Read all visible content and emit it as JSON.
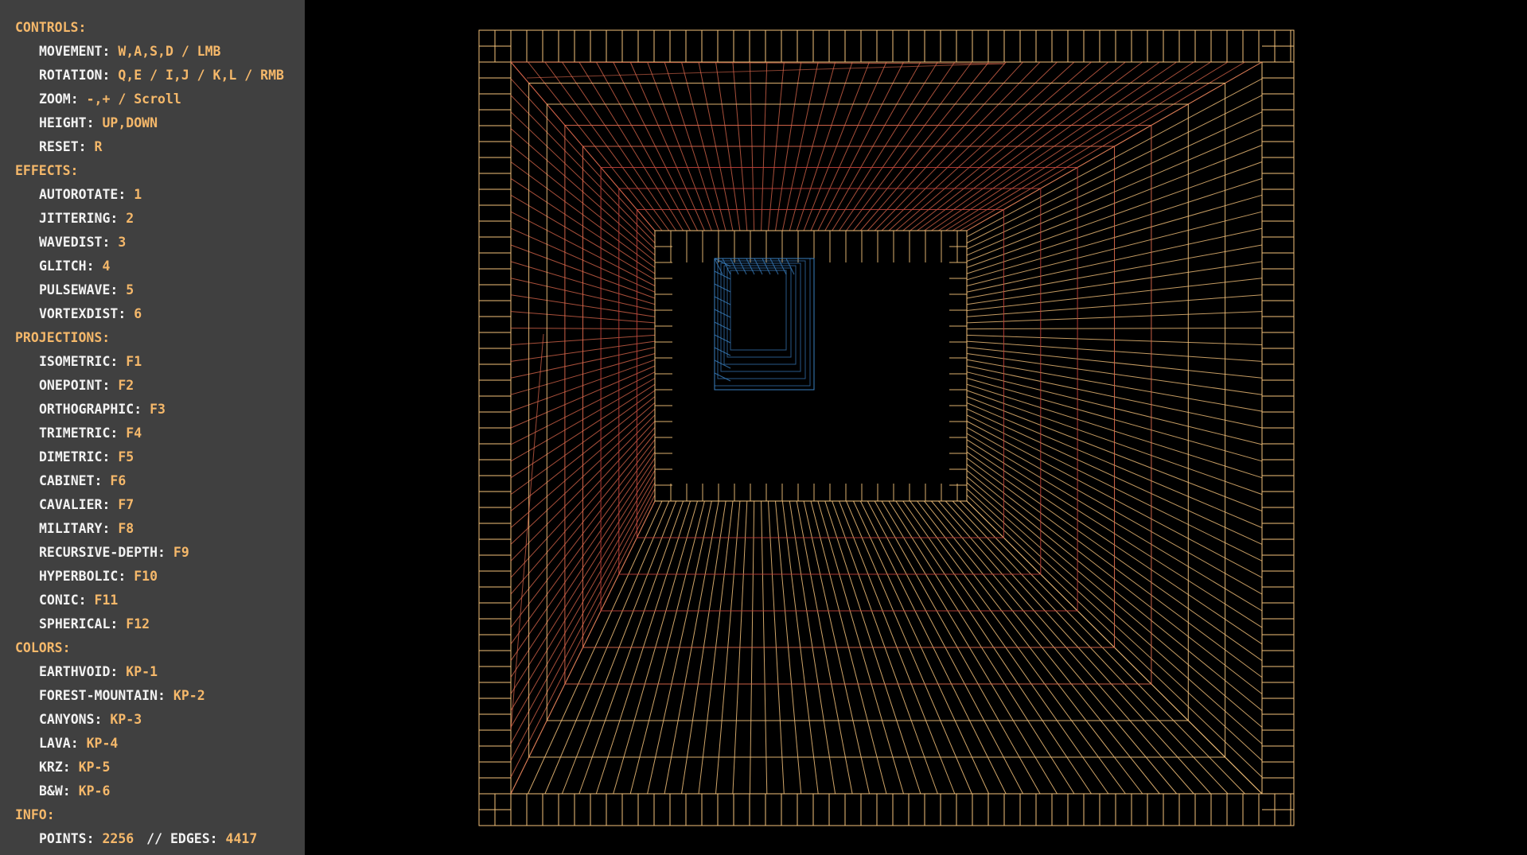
{
  "sidebar": {
    "sections": [
      {
        "title": "CONTROLS:",
        "rows": [
          {
            "label": "MOVEMENT:",
            "key": "W,A,S,D / LMB"
          },
          {
            "label": "ROTATION:",
            "key": "Q,E / I,J / K,L / RMB"
          },
          {
            "label": "ZOOM:",
            "key": "-,+ / Scroll"
          },
          {
            "label": "HEIGHT:",
            "key": "UP,DOWN"
          },
          {
            "label": "RESET:",
            "key": "R"
          }
        ]
      },
      {
        "title": "EFFECTS:",
        "rows": [
          {
            "label": "AUTOROTATE:",
            "key": "1"
          },
          {
            "label": "JITTERING:",
            "key": "2"
          },
          {
            "label": "WAVEDIST:",
            "key": "3"
          },
          {
            "label": "GLITCH:",
            "key": "4"
          },
          {
            "label": "PULSEWAVE:",
            "key": "5"
          },
          {
            "label": "VORTEXDIST:",
            "key": "6"
          }
        ]
      },
      {
        "title": "PROJECTIONS:",
        "rows": [
          {
            "label": "ISOMETRIC:",
            "key": "F1"
          },
          {
            "label": "ONEPOINT:",
            "key": "F2"
          },
          {
            "label": "ORTHOGRAPHIC:",
            "key": "F3"
          },
          {
            "label": "TRIMETRIC:",
            "key": "F4"
          },
          {
            "label": "DIMETRIC:",
            "key": "F5"
          },
          {
            "label": "CABINET:",
            "key": "F6"
          },
          {
            "label": "CAVALIER:",
            "key": "F7"
          },
          {
            "label": "MILITARY:",
            "key": "F8"
          },
          {
            "label": "RECURSIVE-DEPTH:",
            "key": "F9"
          },
          {
            "label": "HYPERBOLIC:",
            "key": "F10"
          },
          {
            "label": "CONIC:",
            "key": "F11"
          },
          {
            "label": "SPHERICAL:",
            "key": "F12"
          }
        ]
      },
      {
        "title": "COLORS:",
        "rows": [
          {
            "label": "EARTHVOID:",
            "key": "KP-1"
          },
          {
            "label": "FOREST-MOUNTAIN:",
            "key": "KP-2"
          },
          {
            "label": "CANYONS:",
            "key": "KP-3"
          },
          {
            "label": "LAVA:",
            "key": "KP-4"
          },
          {
            "label": "KRZ:",
            "key": "KP-5"
          },
          {
            "label": "B&W:",
            "key": "KP-6"
          }
        ]
      },
      {
        "title": "INFO:",
        "info": {
          "points_label": "POINTS:",
          "points_value": "2256",
          "separator": "// EDGES:",
          "edges_value": "4417"
        }
      }
    ]
  },
  "colors": {
    "panel_bg": "#404040",
    "heading": "#f5b86a",
    "text": "#f2f2f2",
    "canvas_bg": "#000000",
    "wire_outer": "#f5c27a",
    "wire_mid": "#e06a4e",
    "wire_deep": "#c0403a",
    "wire_core": "#3a7fc0"
  }
}
